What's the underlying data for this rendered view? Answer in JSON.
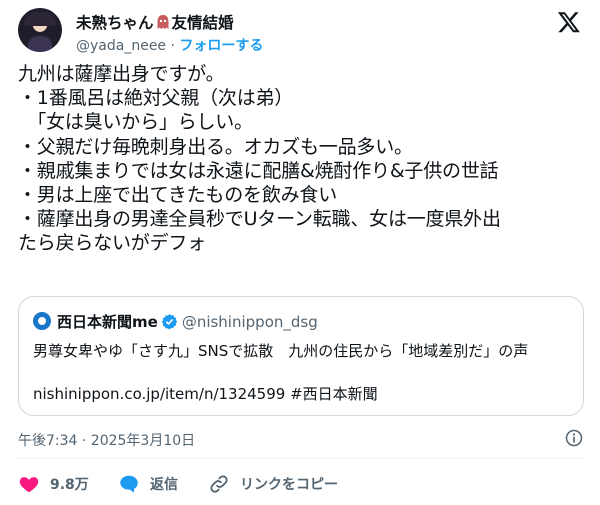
{
  "header": {
    "name": "未熟ちゃん",
    "name_suffix": "友情結婚",
    "handle": "@yada_neee",
    "separator": "·",
    "follow_label": "フォローする"
  },
  "tweet": {
    "lines": [
      "九州は薩摩出身ですが。",
      "・1番風呂は絶対父親（次は弟）",
      "　「女は臭いから」らしい。",
      "・父親だけ毎晩刺身出る。オカズも一品多い。",
      "・親戚集まりでは女は永遠に配膳&焼酎作り&子供の世話",
      "・男は上座で出てきたものを飲み食い",
      "・薩摩出身の男達全員秒でUターン転職、女は一度県外出",
      "たら戻らないがデフォ"
    ]
  },
  "card": {
    "source_name": "西日本新聞me",
    "source_handle": "@nishinippon_dsg",
    "body": "男尊女卑やゆ「さす九」SNSで拡散　九州の住民から「地域差別だ」の声",
    "link": "nishinippon.co.jp/item/n/1324599 #西日本新聞",
    "accent": "#1877c9"
  },
  "meta": {
    "timestamp": "午後7:34 · 2025年3月10日"
  },
  "actions": {
    "like_count": "9.8万",
    "reply_label": "返信",
    "copy_link_label": "リンクをコピー"
  },
  "colors": {
    "like": "#f91880",
    "reply": "#1d9bf0",
    "follow": "#1d9bf0",
    "muted": "#536471"
  },
  "icons": [
    "x-logo-icon",
    "verified-icon",
    "info-icon",
    "heart-icon",
    "reply-icon",
    "link-icon"
  ]
}
